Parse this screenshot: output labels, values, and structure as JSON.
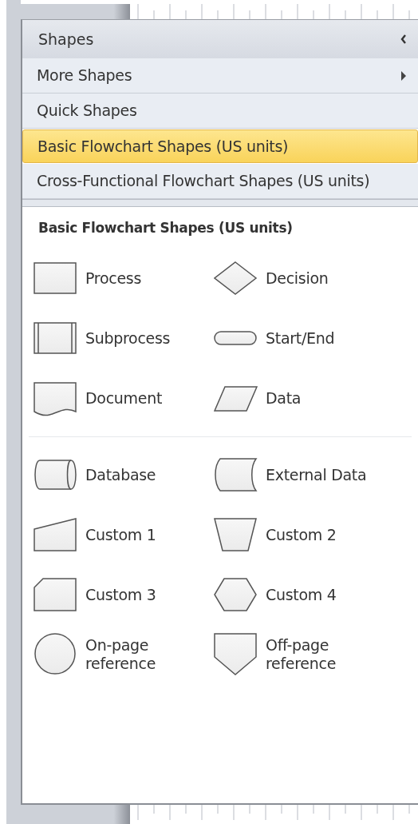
{
  "panel": {
    "title": "Shapes"
  },
  "menu": [
    {
      "label": "More Shapes",
      "kind": "submenu",
      "selected": false
    },
    {
      "label": "Quick Shapes",
      "kind": "stencil",
      "selected": false
    },
    {
      "label": "Basic Flowchart Shapes (US units)",
      "kind": "stencil",
      "selected": true
    },
    {
      "label": "Cross-Functional Flowchart Shapes (US units)",
      "kind": "stencil",
      "selected": false
    }
  ],
  "stencil": {
    "title": "Basic Flowchart Shapes (US units)",
    "groups": [
      [
        {
          "label": "Process",
          "kind": "process"
        },
        {
          "label": "Decision",
          "kind": "decision"
        },
        {
          "label": "Subprocess",
          "kind": "subprocess"
        },
        {
          "label": "Start/End",
          "kind": "terminator"
        },
        {
          "label": "Document",
          "kind": "document"
        },
        {
          "label": "Data",
          "kind": "data"
        }
      ],
      [
        {
          "label": "Database",
          "kind": "database"
        },
        {
          "label": "External Data",
          "kind": "external"
        },
        {
          "label": "Custom 1",
          "kind": "custom1"
        },
        {
          "label": "Custom 2",
          "kind": "custom2"
        },
        {
          "label": "Custom 3",
          "kind": "custom3"
        },
        {
          "label": "Custom 4",
          "kind": "custom4"
        },
        {
          "label": "On-page\nreference",
          "kind": "onpage"
        },
        {
          "label": "Off-page\nreference",
          "kind": "offpage"
        }
      ]
    ]
  }
}
